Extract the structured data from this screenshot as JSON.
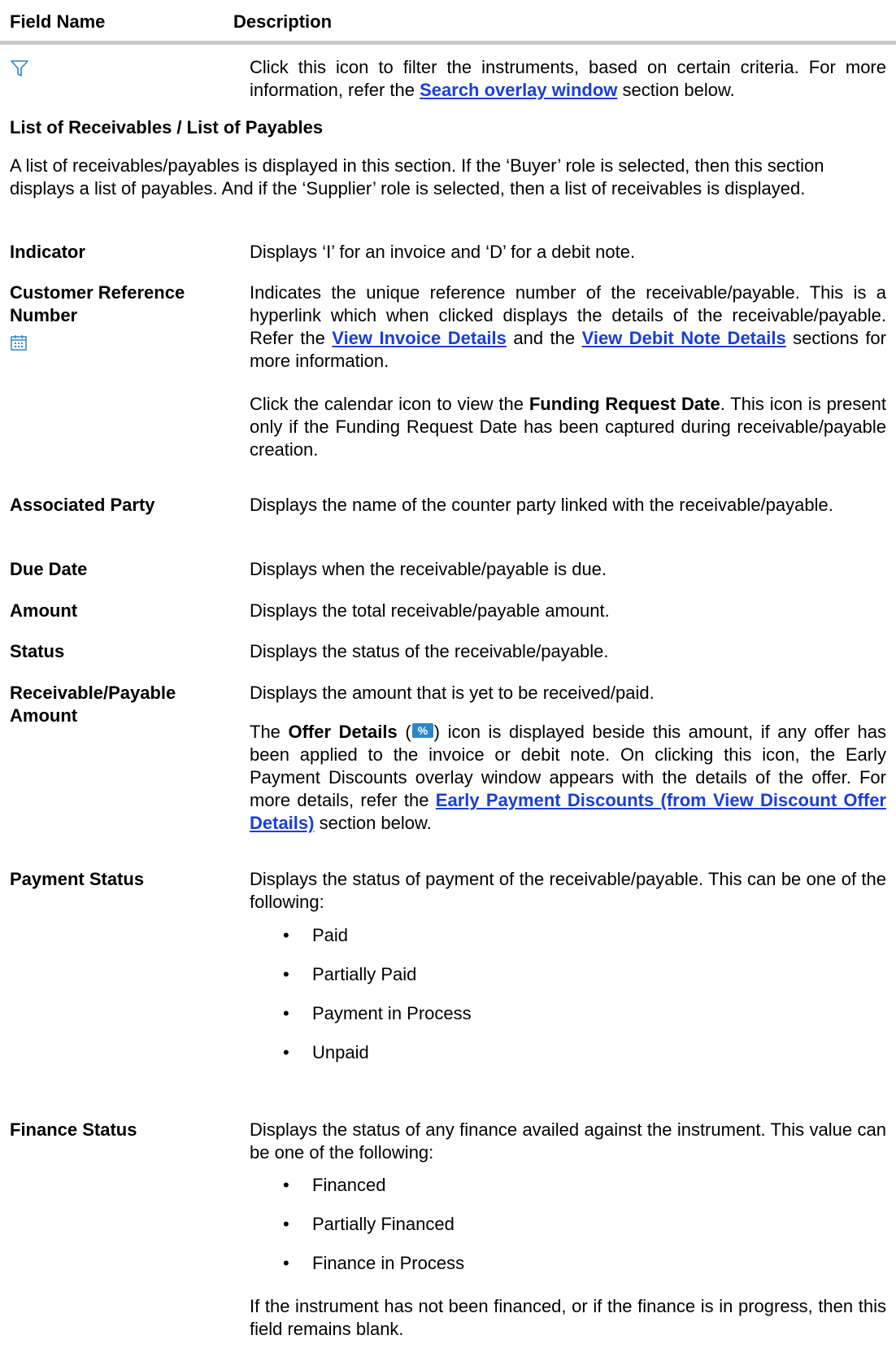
{
  "header": {
    "field_col": "Field Name",
    "desc_col": "Description"
  },
  "filter": {
    "icon": "filter-icon",
    "desc_before": "Click this icon to filter the instruments, based on certain criteria. For more information, refer the ",
    "link": "Search overlay window",
    "desc_after": " section below."
  },
  "section": {
    "heading": "List of Receivables / List of Payables",
    "intro": "A list of receivables/payables is displayed in this section. If the ‘Buyer’ role is selected, then this section displays a list of payables. And if the ‘Supplier’ role is selected, then a list of receivables is displayed."
  },
  "fields": {
    "indicator": {
      "label": "Indicator",
      "desc": "Displays ‘I’ for an invoice and ‘D’ for a debit note."
    },
    "customer_ref": {
      "label": "Customer Reference Number",
      "icon": "calendar-icon",
      "desc1_before": "Indicates the unique reference number of the receivable/payable. This is a hyperlink which when clicked displays the details of the receivable/payable. Refer the ",
      "link1": "View Invoice Details",
      "desc1_mid": " and the ",
      "link2": "View Debit Note Details",
      "desc1_after": " sections for more information.",
      "desc2_before": "Click the calendar icon to view the ",
      "desc2_bold": "Funding Request Date",
      "desc2_after": ". This icon is present only if the Funding Request Date has been captured during receivable/payable creation."
    },
    "associated_party": {
      "label": "Associated Party",
      "desc": "Displays the name of the counter party linked with the receivable/payable."
    },
    "due_date": {
      "label": "Due Date",
      "desc": "Displays when the receivable/payable is due."
    },
    "amount": {
      "label": "Amount",
      "desc": "Displays the total receivable/payable amount."
    },
    "status": {
      "label": "Status",
      "desc": "Displays the status of the receivable/payable."
    },
    "receivable_amount": {
      "label": "Receivable/Payable Amount",
      "desc1": "Displays the amount that is yet to be received/paid.",
      "desc2_pre": "The ",
      "desc2_bold": "Offer Details",
      "desc2_open": " (",
      "offer_icon": "offer-details-icon",
      "desc2_close": ")",
      "desc2_after": " icon is displayed beside this amount, if any offer has been applied to the invoice or debit note. On clicking this icon, the Early Payment Discounts overlay window appears with the details of the offer. For more details, refer the ",
      "link": "Early Payment Discounts (from View Discount Offer Details)",
      "desc2_end": " section below."
    },
    "payment_status": {
      "label": "Payment Status",
      "desc": "Displays the status of payment of the receivable/payable. This can be one of the following:",
      "items": [
        "Paid",
        "Partially Paid",
        "Payment in Process",
        "Unpaid"
      ]
    },
    "finance_status": {
      "label": "Finance Status",
      "desc": "Displays the status of any finance availed against the instrument. This value can be one of the following:",
      "items": [
        "Financed",
        "Partially Financed",
        "Finance in Process"
      ],
      "note": "If the instrument has not been financed, or if the finance is in progress, then this field remains blank."
    }
  },
  "colors": {
    "link": "#1a3fd4",
    "icon": "#2f86c8",
    "header_rule": "#c8c8c8"
  }
}
